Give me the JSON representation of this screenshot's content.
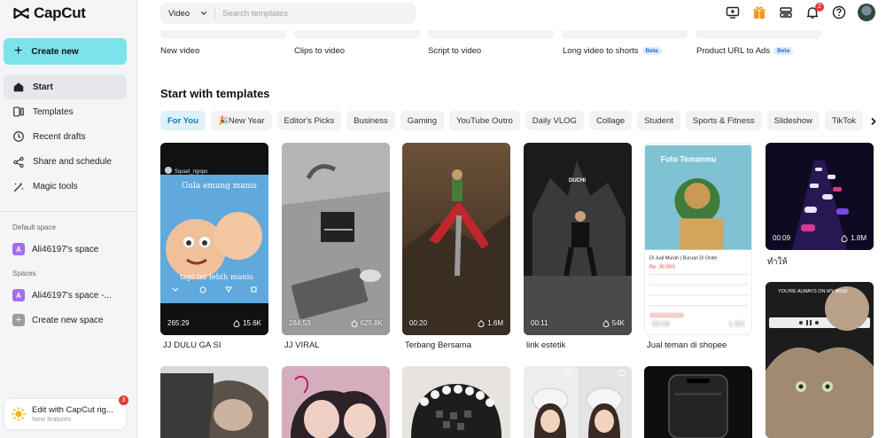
{
  "app": {
    "name": "CapCut"
  },
  "sidebar": {
    "create_label": "Create new",
    "nav": [
      {
        "label": "Start",
        "icon": "home-icon",
        "active": true
      },
      {
        "label": "Templates",
        "icon": "templates-icon",
        "active": false
      },
      {
        "label": "Recent drafts",
        "icon": "clock-icon",
        "active": false
      },
      {
        "label": "Share and schedule",
        "icon": "share-icon",
        "active": false
      },
      {
        "label": "Magic tools",
        "icon": "magic-wand-icon",
        "active": false
      }
    ],
    "default_space_title": "Default space",
    "default_space": {
      "badge": "A",
      "label": "Ali46197's space"
    },
    "spaces_title": "Spaces",
    "spaces": [
      {
        "badge": "A",
        "label": "Ali46197's space -..."
      },
      {
        "badge": "+",
        "label": "Create new space"
      }
    ],
    "promo": {
      "title": "Edit with CapCut rig...",
      "subtitle": "New features",
      "badge": "3"
    }
  },
  "header": {
    "search_type": "Video",
    "search_placeholder": "Search templates",
    "notification_count": "2"
  },
  "quick_actions": [
    {
      "label": "New video",
      "beta": ""
    },
    {
      "label": "Clips to video",
      "beta": ""
    },
    {
      "label": "Script to video",
      "beta": ""
    },
    {
      "label": "Long video to shorts",
      "beta": "Beta"
    },
    {
      "label": "Product URL to Ads",
      "beta": "Beta"
    }
  ],
  "templates": {
    "title": "Start with templates",
    "chips": [
      "For You",
      "🎉New Year",
      "Editor's Picks",
      "Business",
      "Gaming",
      "YouTube Outro",
      "Daily VLOG",
      "Collage",
      "Student",
      "Sports & Fitness",
      "Slideshow",
      "TikTok"
    ],
    "active_chip": "For You",
    "cards": [
      {
        "title": "JJ DULU GA SI",
        "duration": "265:29",
        "uses": "15.6K",
        "overlay_top": "Gula emang manis",
        "overlay_bottom": "tapi ini lebih manis",
        "author": "Squad_ngopo"
      },
      {
        "title": "JJ VIRAL",
        "duration": "284:53",
        "uses": "625.8K"
      },
      {
        "title": "Terbang Bersama",
        "duration": "00:20",
        "uses": "1.6M"
      },
      {
        "title": "lirik estetik",
        "duration": "00:11",
        "uses": "54K",
        "overlay_top": "DUCHI"
      },
      {
        "title": "Jual teman di shopee",
        "duration": "00:08",
        "uses": "1.5M",
        "overlay_top": "Foto Temanmu",
        "product_name": "Di Jual Murah | Buruan Di Order",
        "price": "Rp. 30.000"
      },
      {
        "title": "ทำให้",
        "duration": "00:09",
        "uses": "1.8M"
      },
      {
        "title": "",
        "duration": "",
        "uses": "",
        "overlay_top": "YOU'RE ALWAYS ON MY MIND"
      }
    ]
  },
  "colors": {
    "accent": "#7de3ea",
    "chip_active_bg": "#dff1f8",
    "chip_active_text": "#0f7aa8",
    "badge_purple": "#a56cf0",
    "notification_red": "#e53935"
  }
}
